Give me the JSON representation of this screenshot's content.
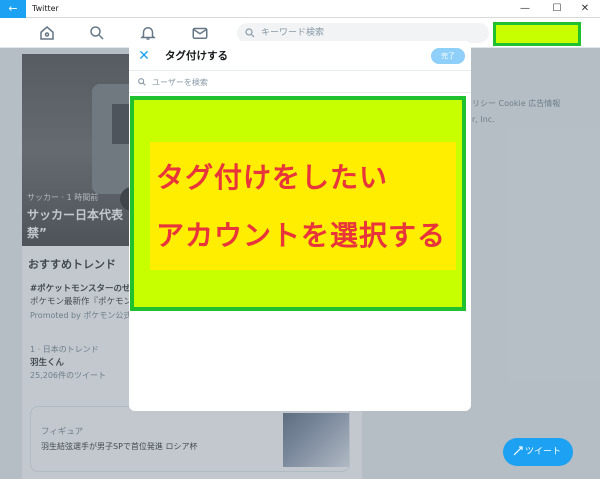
{
  "window": {
    "title": "Twitter",
    "back_glyph": "←",
    "minimize_glyph": "—",
    "maximize_glyph": "☐",
    "close_glyph": "✕"
  },
  "navbar": {
    "search_placeholder": "キーワード検索"
  },
  "background": {
    "hero_meta": "サッカー · 1 時間前",
    "hero_title": "サッカー日本代表 禁”",
    "section_title": "おすすめトレンド",
    "trends": [
      {
        "title": "#ポケットモンスターのせ",
        "subtitle": "ポケモン最新作『ポケモン",
        "promo": "Promoted by ポケモン公式"
      },
      {
        "rank": "1 · 日本のトレンド",
        "title": "羽生くん",
        "count": "25,206件のツイート"
      }
    ],
    "card": {
      "tag": "フィギュア",
      "text": "羽生結弦選手が男子SPで首位発進 ロシア杯"
    },
    "right_links_1": "リシー  Cookie  広告情報",
    "right_links_2": "r, Inc."
  },
  "tweet_button": {
    "label": "ツイート"
  },
  "modal": {
    "close_glyph": "✕",
    "title": "タグ付けする",
    "done_label": "完了",
    "search_placeholder": "ユーザーを検索"
  },
  "callout": {
    "line1": "タグ付けをしたい",
    "line2": "アカウントを選択する"
  },
  "colors": {
    "accent": "#1da1f2",
    "highlight_fill": "#c8ff00",
    "highlight_border": "#1fc12e",
    "callout_inner": "#ffee00",
    "callout_text": "#e8343b"
  }
}
